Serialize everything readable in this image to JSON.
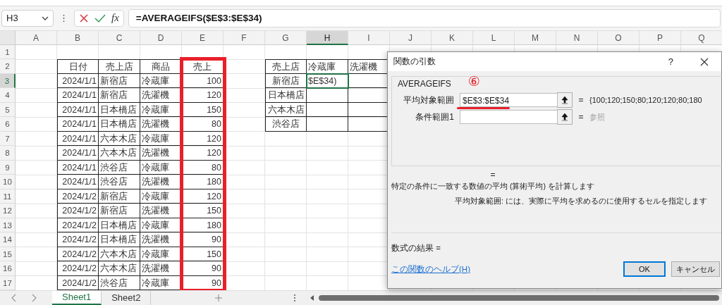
{
  "formula_bar": {
    "name_box": "H3",
    "more": "⋮",
    "formula": "=AVERAGEIFS($E$3:$E$34)",
    "fx": "fx"
  },
  "columns": [
    {
      "label": "A",
      "selected": false
    },
    {
      "label": "B",
      "selected": false
    },
    {
      "label": "C",
      "selected": false
    },
    {
      "label": "D",
      "selected": false
    },
    {
      "label": "E",
      "selected": false
    },
    {
      "label": "F",
      "selected": false
    },
    {
      "label": "G",
      "selected": false
    },
    {
      "label": "H",
      "selected": true
    },
    {
      "label": "I",
      "selected": false
    },
    {
      "label": "J",
      "selected": false
    },
    {
      "label": "K",
      "selected": false
    },
    {
      "label": "L",
      "selected": false
    },
    {
      "label": "M",
      "selected": false
    },
    {
      "label": "N",
      "selected": false
    },
    {
      "label": "O",
      "selected": false
    },
    {
      "label": "P",
      "selected": false
    },
    {
      "label": "Q",
      "selected": false
    }
  ],
  "rows": [
    {
      "label": "1",
      "selected": false
    },
    {
      "label": "2",
      "selected": false,
      "cells": [
        null,
        {
          "text": "日付",
          "kind": "header",
          "bordered": true
        },
        {
          "text": "売上店",
          "kind": "header",
          "bordered": true
        },
        {
          "text": "商品",
          "kind": "header",
          "bordered": true
        },
        {
          "text": "売上",
          "kind": "header",
          "bordered": true,
          "highlighted": true
        },
        null,
        {
          "text": "売上店",
          "kind": "header",
          "bordered": true
        },
        {
          "text": "冷蔵庫",
          "kind": "text",
          "bordered": true
        },
        {
          "text": "洗濯機",
          "kind": "text",
          "bordered": true
        }
      ]
    },
    {
      "label": "3",
      "selected": true,
      "cells": [
        null,
        {
          "text": "2024/1/1",
          "kind": "number",
          "bordered": true
        },
        {
          "text": "新宿店",
          "kind": "text",
          "bordered": true
        },
        {
          "text": "冷蔵庫",
          "kind": "text",
          "bordered": true
        },
        {
          "text": "100",
          "kind": "number",
          "bordered": true,
          "highlighted": true
        },
        null,
        {
          "text": "新宿店",
          "kind": "header",
          "bordered": true
        },
        {
          "text": "$E$34)",
          "kind": "text",
          "bordered": true
        },
        {
          "bordered": true
        }
      ]
    },
    {
      "label": "4",
      "selected": false,
      "cells": [
        null,
        {
          "text": "2024/1/1",
          "kind": "number",
          "bordered": true
        },
        {
          "text": "新宿店",
          "kind": "text",
          "bordered": true
        },
        {
          "text": "洗濯機",
          "kind": "text",
          "bordered": true
        },
        {
          "text": "120",
          "kind": "number",
          "bordered": true,
          "highlighted": true
        },
        null,
        {
          "text": "日本橋店",
          "kind": "header",
          "bordered": true
        },
        {
          "bordered": true
        },
        {
          "bordered": true
        }
      ]
    },
    {
      "label": "5",
      "selected": false,
      "cells": [
        null,
        {
          "text": "2024/1/1",
          "kind": "number",
          "bordered": true
        },
        {
          "text": "日本橋店",
          "kind": "text",
          "bordered": true
        },
        {
          "text": "冷蔵庫",
          "kind": "text",
          "bordered": true
        },
        {
          "text": "150",
          "kind": "number",
          "bordered": true,
          "highlighted": true
        },
        null,
        {
          "text": "六本木店",
          "kind": "header",
          "bordered": true
        },
        {
          "bordered": true
        },
        {
          "bordered": true
        }
      ]
    },
    {
      "label": "6",
      "selected": false,
      "cells": [
        null,
        {
          "text": "2024/1/1",
          "kind": "number",
          "bordered": true
        },
        {
          "text": "日本橋店",
          "kind": "text",
          "bordered": true
        },
        {
          "text": "洗濯機",
          "kind": "text",
          "bordered": true
        },
        {
          "text": "80",
          "kind": "number",
          "bordered": true,
          "highlighted": true
        },
        null,
        {
          "text": "渋谷店",
          "kind": "header",
          "bordered": true
        },
        {
          "bordered": true
        },
        {
          "bordered": true
        }
      ]
    },
    {
      "label": "7",
      "selected": false,
      "cells": [
        null,
        {
          "text": "2024/1/1",
          "kind": "number",
          "bordered": true
        },
        {
          "text": "六本木店",
          "kind": "text",
          "bordered": true
        },
        {
          "text": "冷蔵庫",
          "kind": "text",
          "bordered": true
        },
        {
          "text": "120",
          "kind": "number",
          "bordered": true,
          "highlighted": true
        }
      ]
    },
    {
      "label": "8",
      "selected": false,
      "cells": [
        null,
        {
          "text": "2024/1/1",
          "kind": "number",
          "bordered": true
        },
        {
          "text": "六本木店",
          "kind": "text",
          "bordered": true
        },
        {
          "text": "洗濯機",
          "kind": "text",
          "bordered": true
        },
        {
          "text": "120",
          "kind": "number",
          "bordered": true,
          "highlighted": true
        }
      ]
    },
    {
      "label": "9",
      "selected": false,
      "cells": [
        null,
        {
          "text": "2024/1/1",
          "kind": "number",
          "bordered": true
        },
        {
          "text": "渋谷店",
          "kind": "text",
          "bordered": true
        },
        {
          "text": "冷蔵庫",
          "kind": "text",
          "bordered": true
        },
        {
          "text": "80",
          "kind": "number",
          "bordered": true,
          "highlighted": true
        }
      ]
    },
    {
      "label": "10",
      "selected": false,
      "cells": [
        null,
        {
          "text": "2024/1/1",
          "kind": "number",
          "bordered": true
        },
        {
          "text": "渋谷店",
          "kind": "text",
          "bordered": true
        },
        {
          "text": "洗濯機",
          "kind": "text",
          "bordered": true
        },
        {
          "text": "180",
          "kind": "number",
          "bordered": true,
          "highlighted": true
        }
      ]
    },
    {
      "label": "11",
      "selected": false,
      "cells": [
        null,
        {
          "text": "2024/1/2",
          "kind": "number",
          "bordered": true
        },
        {
          "text": "新宿店",
          "kind": "text",
          "bordered": true
        },
        {
          "text": "冷蔵庫",
          "kind": "text",
          "bordered": true
        },
        {
          "text": "120",
          "kind": "number",
          "bordered": true,
          "highlighted": true
        }
      ]
    },
    {
      "label": "12",
      "selected": false,
      "cells": [
        null,
        {
          "text": "2024/1/2",
          "kind": "number",
          "bordered": true
        },
        {
          "text": "新宿店",
          "kind": "text",
          "bordered": true
        },
        {
          "text": "洗濯機",
          "kind": "text",
          "bordered": true
        },
        {
          "text": "150",
          "kind": "number",
          "bordered": true,
          "highlighted": true
        }
      ]
    },
    {
      "label": "13",
      "selected": false,
      "cells": [
        null,
        {
          "text": "2024/1/2",
          "kind": "number",
          "bordered": true
        },
        {
          "text": "日本橋店",
          "kind": "text",
          "bordered": true
        },
        {
          "text": "冷蔵庫",
          "kind": "text",
          "bordered": true
        },
        {
          "text": "180",
          "kind": "number",
          "bordered": true,
          "highlighted": true
        }
      ]
    },
    {
      "label": "14",
      "selected": false,
      "cells": [
        null,
        {
          "text": "2024/1/2",
          "kind": "number",
          "bordered": true
        },
        {
          "text": "日本橋店",
          "kind": "text",
          "bordered": true
        },
        {
          "text": "洗濯機",
          "kind": "text",
          "bordered": true
        },
        {
          "text": "90",
          "kind": "number",
          "bordered": true,
          "highlighted": true
        }
      ]
    },
    {
      "label": "15",
      "selected": false,
      "cells": [
        null,
        {
          "text": "2024/1/2",
          "kind": "number",
          "bordered": true
        },
        {
          "text": "六本木店",
          "kind": "text",
          "bordered": true
        },
        {
          "text": "冷蔵庫",
          "kind": "text",
          "bordered": true
        },
        {
          "text": "150",
          "kind": "number",
          "bordered": true,
          "highlighted": true
        }
      ]
    },
    {
      "label": "16",
      "selected": false,
      "cells": [
        null,
        {
          "text": "2024/1/2",
          "kind": "number",
          "bordered": true
        },
        {
          "text": "六本木店",
          "kind": "text",
          "bordered": true
        },
        {
          "text": "洗濯機",
          "kind": "text",
          "bordered": true
        },
        {
          "text": "90",
          "kind": "number",
          "bordered": true,
          "highlighted": true
        }
      ]
    },
    {
      "label": "17",
      "selected": false,
      "cells": [
        null,
        {
          "text": "2024/1/2",
          "kind": "number",
          "bordered": true
        },
        {
          "text": "渋谷店",
          "kind": "text",
          "bordered": true
        },
        {
          "text": "冷蔵庫",
          "kind": "text",
          "bordered": true
        },
        {
          "text": "90",
          "kind": "number",
          "bordered": true,
          "highlighted": true
        }
      ]
    }
  ],
  "sheet_tabs": [
    {
      "label": "Sheet1",
      "selected": true
    },
    {
      "label": "Sheet2",
      "selected": false
    }
  ],
  "dialog": {
    "title": "関数の引数",
    "help": "?",
    "function_name": "AVERAGEIFS",
    "step_badge": "⑥",
    "arguments": [
      {
        "label": "平均対象範囲",
        "value": "$E$3:$E$34",
        "result": "{100;120;150;80;120;120;80;180",
        "muted": false,
        "underlined": true
      },
      {
        "label": "条件範囲1",
        "result": "参照",
        "muted": true,
        "underlined": false
      }
    ],
    "equals": "=",
    "description": "特定の条件に一致する数値の平均 (算術平均) を計算します",
    "argument_help": "平均対象範囲:  には、実際に平均を求めるのに使用するセルを指定します",
    "formula_result": "数式の結果 =",
    "help_link": "この関数のヘルプ(H)",
    "buttons": [
      {
        "label": "OK",
        "default": true
      },
      {
        "label": "キャンセル",
        "default": false
      }
    ]
  }
}
